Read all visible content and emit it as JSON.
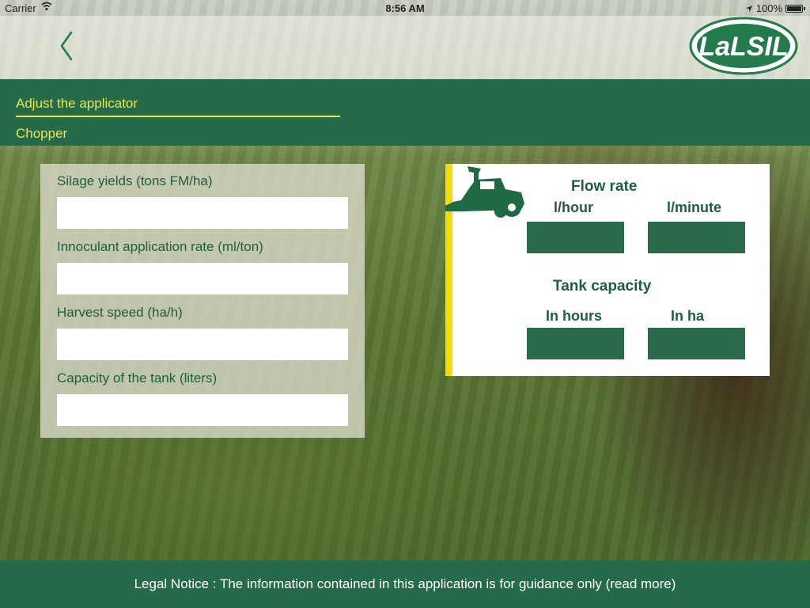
{
  "status_bar": {
    "carrier": "Carrier",
    "time": "8:56 AM",
    "battery": "100%"
  },
  "nav": {
    "back_icon": "chevron-left-icon",
    "logo_text": "LaLSIL"
  },
  "header": {
    "title": "Adjust the applicator",
    "subtitle": "Chopper"
  },
  "form": {
    "fields": [
      {
        "label": "Silage yields (tons FM/ha)",
        "value": ""
      },
      {
        "label": "Innoculant application rate (ml/ton)",
        "value": ""
      },
      {
        "label": "Harvest speed (ha/h)",
        "value": ""
      },
      {
        "label": "Capacity of the tank (liters)",
        "value": ""
      }
    ]
  },
  "results": {
    "flow_rate": {
      "heading": "Flow rate",
      "left_label": "l/hour",
      "right_label": "l/minute",
      "left_value": "",
      "right_value": ""
    },
    "tank_capacity": {
      "heading": "Tank capacity",
      "left_label": "In hours",
      "right_label": "In ha",
      "left_value": "",
      "right_value": ""
    },
    "image_icon": "forage-harvester-icon"
  },
  "footer": {
    "legal_notice": "Legal Notice : The information contained in this application is for guidance only (read more)"
  },
  "colors": {
    "brand_green": "#256b4a",
    "accent_yellow": "#e9e649",
    "text_green": "#1f5e3f",
    "bar_yellow": "#f2dd08"
  }
}
